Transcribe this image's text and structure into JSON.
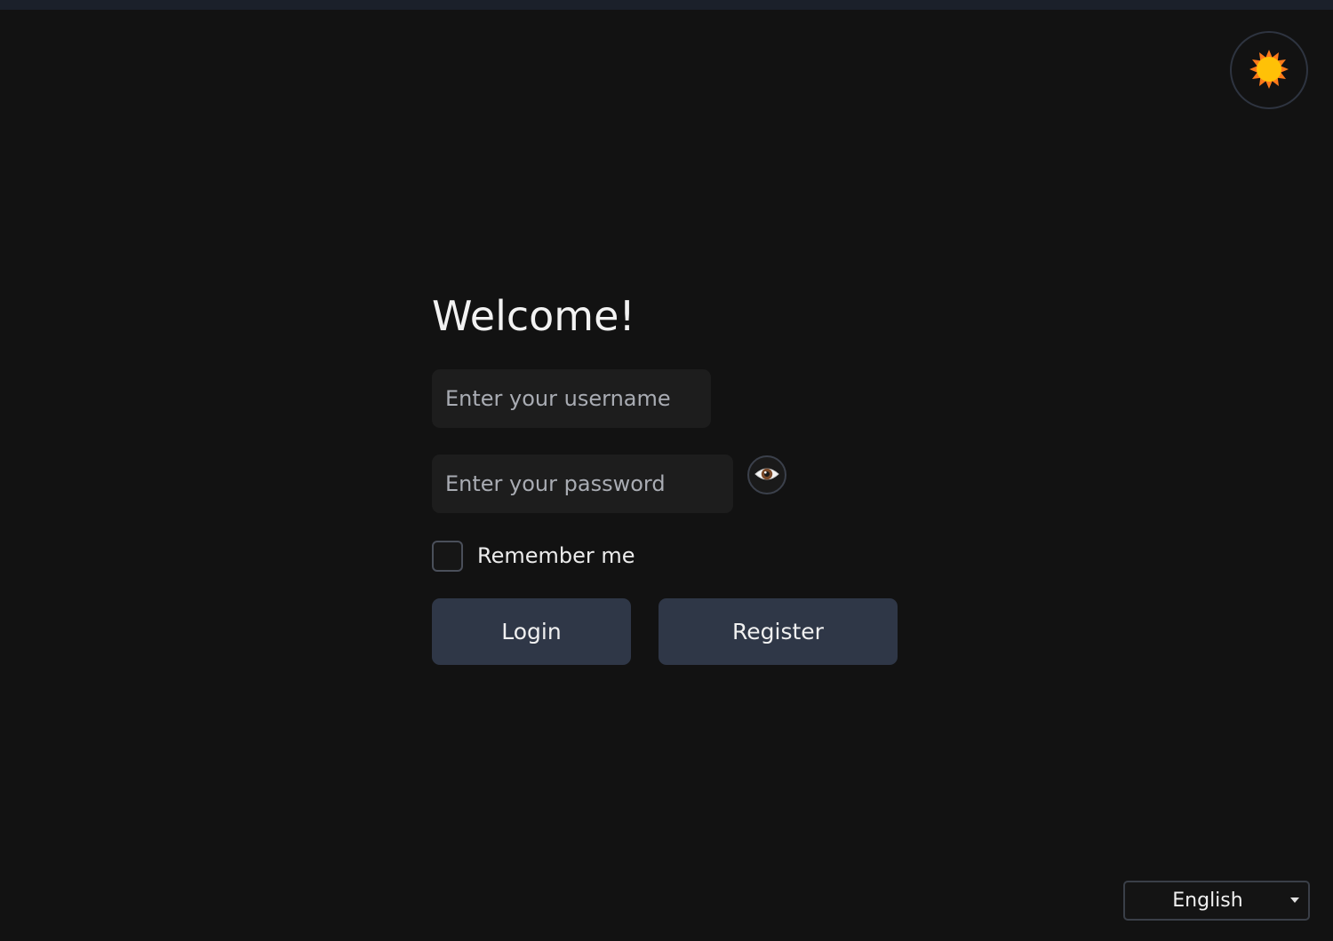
{
  "header": {
    "theme_toggle_icon": "sun-icon",
    "sun_color": "#ffc107",
    "sun_ray_color": "#ff7a1a"
  },
  "login": {
    "title": "Welcome!",
    "username_placeholder": "Enter your username",
    "password_placeholder": "Enter your password",
    "toggle_password_icon": "eye-icon",
    "remember_label": "Remember me",
    "remember_checked": false,
    "login_label": "Login",
    "register_label": "Register"
  },
  "footer": {
    "language": {
      "selected": "English"
    }
  },
  "colors": {
    "background": "#121212",
    "input_bg": "#1d1d1d",
    "button_bg": "#2f3747"
  }
}
